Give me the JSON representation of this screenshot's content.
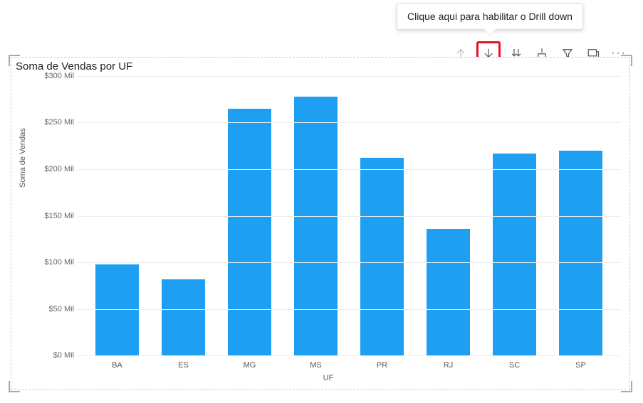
{
  "tooltip_text": "Clique aqui para habilitar o Drill down",
  "chart_title": "Soma de Vendas por UF",
  "yaxis_label": "Soma de Vendas",
  "xaxis_label": "UF",
  "chart_data": {
    "type": "bar",
    "title": "Soma de Vendas por UF",
    "xlabel": "UF",
    "ylabel": "Soma de Vendas",
    "ylim": [
      0,
      300
    ],
    "y_unit": "Mil (thousands, currency)",
    "categories": [
      "BA",
      "ES",
      "MG",
      "MS",
      "PR",
      "RJ",
      "SC",
      "SP"
    ],
    "values": [
      98,
      82,
      265,
      278,
      212,
      136,
      217,
      220
    ],
    "y_ticks": [
      0,
      50,
      100,
      150,
      200,
      250,
      300
    ],
    "y_tick_labels": [
      "$0 Mil",
      "$50 Mil",
      "$100 Mil",
      "$150 Mil",
      "$200 Mil",
      "$250 Mil",
      "$300 Mil"
    ]
  },
  "toolbar": {
    "drill_up": "drill-up",
    "drill_down": "drill-down",
    "expand_all": "expand-all-down",
    "next_level": "next-level",
    "filter": "filter",
    "focus": "focus-mode",
    "more": "more-options"
  }
}
